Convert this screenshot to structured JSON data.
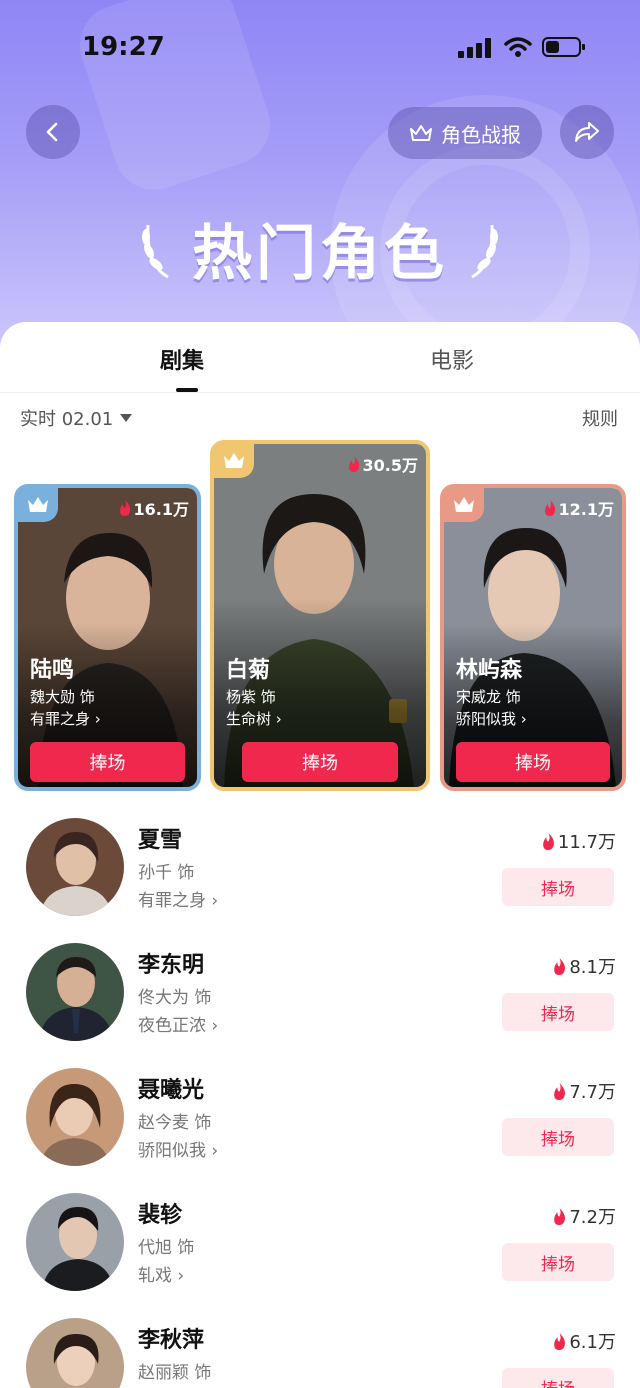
{
  "status_bar": {
    "time": "19:27"
  },
  "header": {
    "report_button_label": "角色战报",
    "title": "热门角色"
  },
  "tabs": [
    {
      "label": "剧集"
    },
    {
      "label": "电影"
    }
  ],
  "filter": {
    "label": "实时 02.01",
    "rules_label": "规则"
  },
  "top_cards": [
    {
      "rank": 2,
      "heat": "16.1万",
      "name": "陆鸣",
      "actor": "魏大勋 饰",
      "show": "有罪之身",
      "button": "捧场",
      "frame_color": "#7ab0dc"
    },
    {
      "rank": 1,
      "heat": "30.5万",
      "name": "白菊",
      "actor": "杨紫 饰",
      "show": "生命树",
      "button": "捧场",
      "frame_color": "#f0c770"
    },
    {
      "rank": 3,
      "heat": "12.1万",
      "name": "林屿森",
      "actor": "宋威龙 饰",
      "show": "骄阳似我",
      "button": "捧场",
      "frame_color": "#e99a86"
    }
  ],
  "list": [
    {
      "name": "夏雪",
      "actor": "孙千 饰",
      "show": "有罪之身",
      "heat": "11.7万",
      "button": "捧场"
    },
    {
      "name": "李东明",
      "actor": "佟大为 饰",
      "show": "夜色正浓",
      "heat": "8.1万",
      "button": "捧场"
    },
    {
      "name": "聂曦光",
      "actor": "赵今麦 饰",
      "show": "骄阳似我",
      "heat": "7.7万",
      "button": "捧场"
    },
    {
      "name": "裴轸",
      "actor": "代旭 饰",
      "show": "轧戏",
      "heat": "7.2万",
      "button": "捧场"
    },
    {
      "name": "李秋萍",
      "actor": "赵丽颖 饰",
      "show": "",
      "heat": "6.1万",
      "button": "捧场"
    }
  ],
  "colors": {
    "accent": "#f0284d",
    "header_gradient_top": "#8f86f5",
    "button_soft": "#fde8ec"
  }
}
